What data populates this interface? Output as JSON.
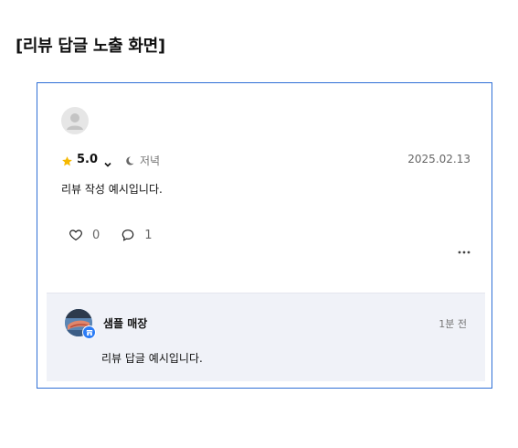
{
  "page": {
    "heading": "[리뷰 답글 노출 화면]"
  },
  "review": {
    "rating": "5.0",
    "meal_time": "저녁",
    "date": "2025.02.13",
    "text": "리뷰 작성 예시입니다.",
    "likes": "0",
    "comments": "1",
    "icons": {
      "avatar": "user-placeholder-icon",
      "star": "star-icon",
      "dropdown": "chevron-down-icon",
      "meal": "moon-icon",
      "like": "heart-icon",
      "comment": "speech-bubble-icon",
      "more": "more-dots-icon"
    },
    "colors": {
      "star": "#f5b800",
      "frame_border": "#2f6fd6"
    }
  },
  "reply": {
    "store_name": "샘플 매장",
    "time": "1분 전",
    "text": "리뷰 답글 예시입니다.",
    "icons": {
      "avatar": "store-avatar",
      "badge": "store-badge-icon"
    },
    "colors": {
      "background": "#f0f2f8",
      "badge": "#2b7cf6"
    }
  }
}
